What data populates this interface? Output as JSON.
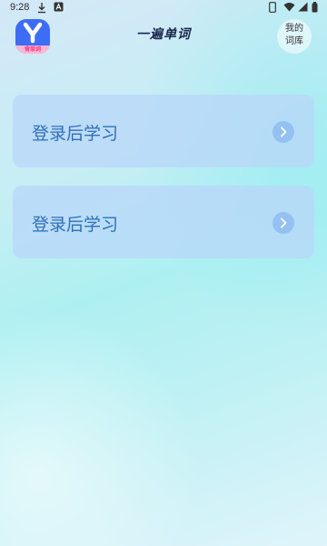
{
  "status_bar": {
    "time": "9:28",
    "icons": [
      "download-icon",
      "app-notification-icon",
      "battery-saver-icon",
      "wifi-icon",
      "signal-icon",
      "battery-icon"
    ]
  },
  "header": {
    "logo_icon": "app-logo-y-icon",
    "logo_text": "背单词",
    "title": "一遍单词",
    "vocab_button": {
      "line1": "我的",
      "line2": "词库"
    }
  },
  "cards": [
    {
      "label": "登录后学习",
      "icon": "chevron-right-icon"
    },
    {
      "label": "登录后学习",
      "icon": "chevron-right-icon"
    }
  ],
  "colors": {
    "accent": "#2f6fb8",
    "logo_bg": "#3d6cf5",
    "logo_strip": "#ffb6d3",
    "card_bg": "#b8d7f8",
    "title": "#17254a"
  }
}
